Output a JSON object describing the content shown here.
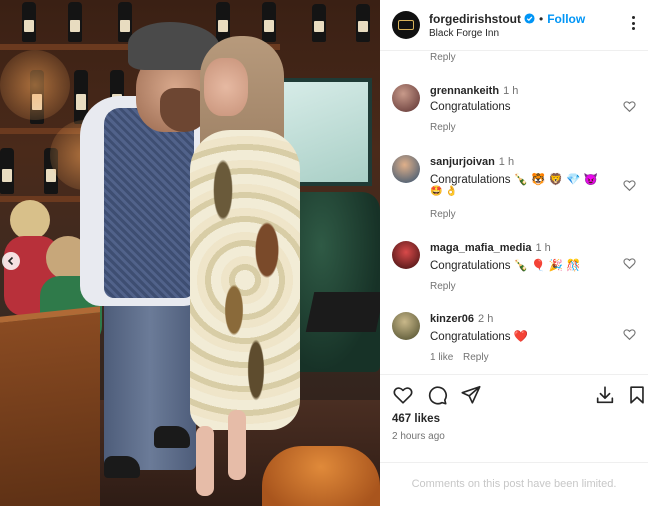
{
  "post": {
    "username": "forgedirishstout",
    "follow_label": "Follow",
    "location": "Black Forge Inn",
    "top_reply_label": "Reply",
    "likes": "467 likes",
    "time_ago": "2 hours ago",
    "comments_limited": "Comments on this post have been limited."
  },
  "comments": [
    {
      "username": "grennankeith",
      "time": "1 h",
      "text": "Congratulations",
      "emoji": "",
      "reply_label": "Reply",
      "avatar_color": "#7a4a4a"
    },
    {
      "username": "sanjurjoivan",
      "time": "1 h",
      "text": "Congratulations 🍾 🐯 🦁 💎 😈",
      "emoji": "🤩 👌",
      "reply_label": "Reply",
      "avatar_color": "#3a6a9a"
    },
    {
      "username": "maga_mafia_media",
      "time": "1 h",
      "text": "Congratulations 🍾 🎈 🎉 🎊",
      "emoji": "",
      "reply_label": "Reply",
      "avatar_color": "#8a1f1f"
    },
    {
      "username": "kinzer06",
      "time": "2 h",
      "text": "Congratulations ❤️",
      "emoji": "",
      "like_count": "1 like",
      "reply_label": "Reply",
      "avatar_color": "#6b6a4a"
    }
  ],
  "colors": {
    "link_blue": "#0095f6",
    "muted": "#737373",
    "heart_red": "#ff3040"
  },
  "icons": [
    "verified-badge-icon",
    "more-options-icon",
    "heart-icon",
    "comment-icon",
    "share-icon",
    "download-icon",
    "bookmark-icon",
    "chevron-left-icon"
  ]
}
